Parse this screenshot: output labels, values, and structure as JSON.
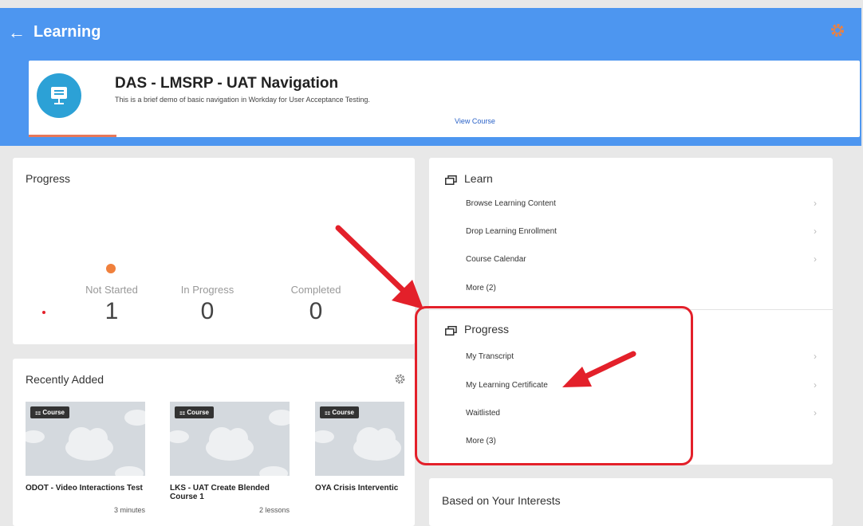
{
  "header": {
    "title": "Learning",
    "back_icon": "←"
  },
  "course": {
    "title": "DAS - LMSRP - UAT Navigation",
    "description": "This is a brief demo of basic navigation in Workday for User Acceptance Testing.",
    "link": "View Course"
  },
  "progress": {
    "heading": "Progress",
    "stats": [
      {
        "label": "Not Started",
        "value": "1"
      },
      {
        "label": "In Progress",
        "value": "0"
      },
      {
        "label": "Completed",
        "value": "0"
      }
    ]
  },
  "recent": {
    "heading": "Recently Added",
    "items": [
      {
        "badge": "Course",
        "title": "ODOT - Video Interactions Test",
        "meta": "3 minutes"
      },
      {
        "badge": "Course",
        "title": "LKS - UAT Create Blended Course 1",
        "meta": "2 lessons"
      },
      {
        "badge": "Course",
        "title": "OYA Crisis Interventic",
        "meta": ""
      }
    ]
  },
  "learn": {
    "heading": "Learn",
    "items": [
      "Browse Learning Content",
      "Drop Learning Enrollment",
      "Course Calendar",
      "More (2)"
    ]
  },
  "progress_menu": {
    "heading": "Progress",
    "items": [
      "My Transcript",
      "My Learning Certificate",
      "Waitlisted",
      "More (3)"
    ]
  },
  "interests": {
    "heading": "Based on Your Interests"
  },
  "colors": {
    "header_bg": "#4d96f0",
    "accent_orange": "#f0803c",
    "annotation_red": "#e3202a",
    "link": "#2a62c8"
  }
}
